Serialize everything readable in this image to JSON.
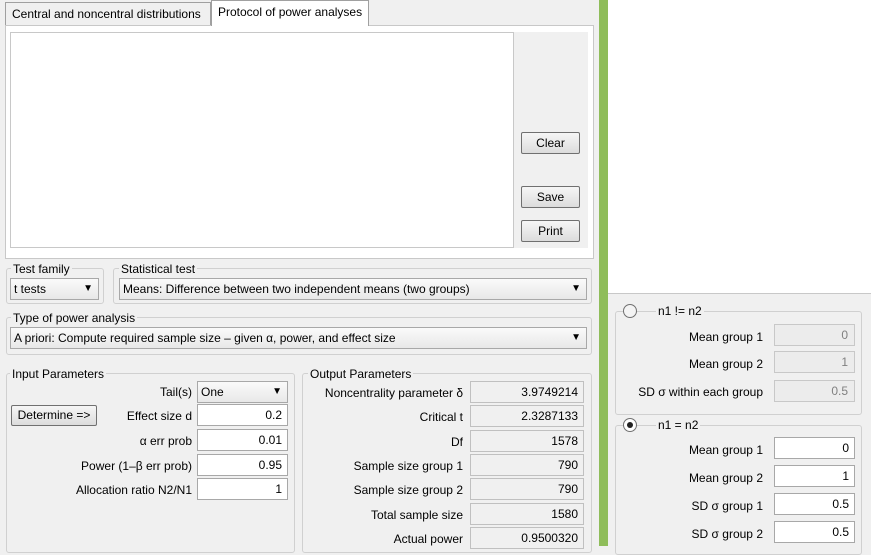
{
  "tabs": [
    {
      "label": "Central and noncentral distributions"
    },
    {
      "label": "Protocol of power analyses"
    }
  ],
  "protocol_buttons": {
    "clear": "Clear",
    "save": "Save",
    "print": "Print"
  },
  "test_family": {
    "label": "Test family",
    "value": "t tests"
  },
  "statistical_test": {
    "label": "Statistical test",
    "value": "Means: Difference between two independent means (two groups)"
  },
  "analysis_type": {
    "label": "Type of power analysis",
    "value": "A priori: Compute required sample size – given α, power, and effect size"
  },
  "input": {
    "title": "Input Parameters",
    "determine_label": "Determine =>",
    "tails_label": "Tail(s)",
    "tails_value": "One",
    "effect_label": "Effect size d",
    "effect_value": "0.2",
    "alpha_label": "α err prob",
    "alpha_value": "0.01",
    "power_label": "Power (1–β err prob)",
    "power_value": "0.95",
    "ratio_label": "Allocation ratio N2/N1",
    "ratio_value": "1"
  },
  "output": {
    "title": "Output Parameters",
    "rows": [
      {
        "label": "Noncentrality parameter δ",
        "value": "3.9749214"
      },
      {
        "label": "Critical t",
        "value": "2.3287133"
      },
      {
        "label": "Df",
        "value": "1578"
      },
      {
        "label": "Sample size group 1",
        "value": "790"
      },
      {
        "label": "Sample size group 2",
        "value": "790"
      },
      {
        "label": "Total sample size",
        "value": "1580"
      },
      {
        "label": "Actual power",
        "value": "0.9500320"
      }
    ]
  },
  "side": {
    "unequal": {
      "label": "n1 != n2",
      "selected": false,
      "rows": [
        {
          "label": "Mean group 1",
          "value": "0"
        },
        {
          "label": "Mean group 2",
          "value": "1"
        },
        {
          "label": "SD σ within each group",
          "value": "0.5"
        }
      ]
    },
    "equal": {
      "label": "n1 = n2",
      "selected": true,
      "rows": [
        {
          "label": "Mean group 1",
          "value": "0"
        },
        {
          "label": "Mean group 2",
          "value": "1"
        },
        {
          "label": "SD σ group 1",
          "value": "0.5"
        },
        {
          "label": "SD σ group 2",
          "value": "0.5"
        }
      ]
    }
  },
  "colors": {
    "divider": "#8fbd5a",
    "window_bg": "#f0f0f0"
  }
}
